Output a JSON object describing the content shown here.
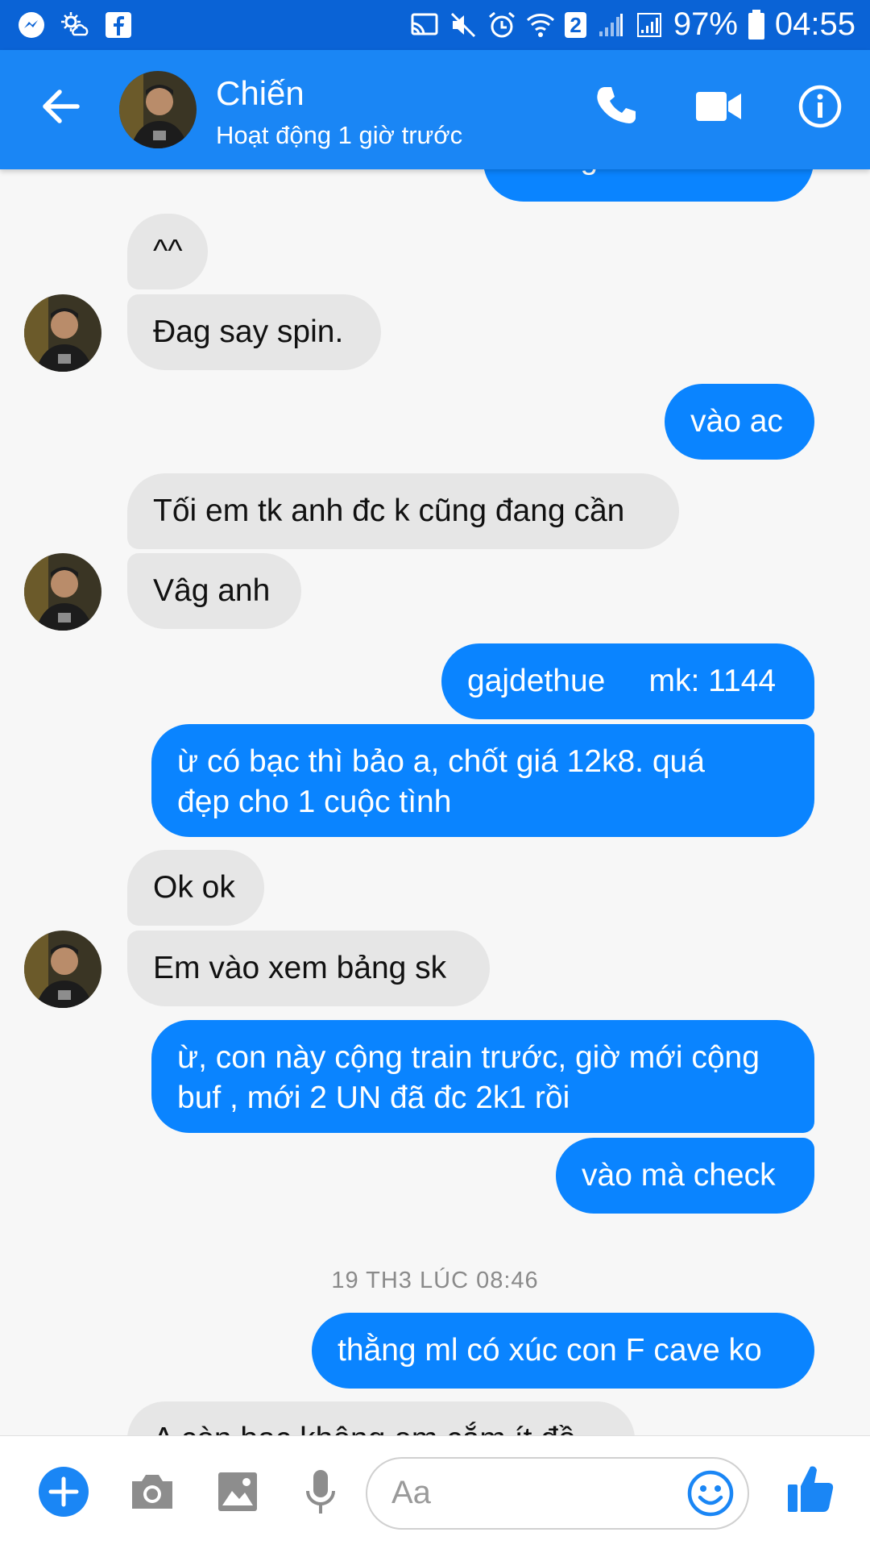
{
  "status_bar": {
    "battery_percent": "97%",
    "time": "04:55",
    "sim_badge": "2"
  },
  "header": {
    "contact_name": "Chiến",
    "activity": "Hoạt động 1 giờ trước"
  },
  "messages": [
    {
      "dir": "out",
      "text": "thằng ml đi đâu rồi"
    },
    {
      "dir": "in",
      "text": "^^"
    },
    {
      "dir": "in",
      "text": "Đag say spin."
    },
    {
      "dir": "out",
      "text": "vào ac"
    },
    {
      "dir": "in",
      "text": "Tối em tk anh đc k cũng đang cần"
    },
    {
      "dir": "in",
      "text": "Vâg anh"
    },
    {
      "dir": "out",
      "text": "gajdethue     mk: 1144"
    },
    {
      "dir": "out",
      "text": "ừ có bạc thì bảo a, chốt giá 12k8. quá\nđẹp cho 1 cuộc tình"
    },
    {
      "dir": "in",
      "text": "Ok ok"
    },
    {
      "dir": "in",
      "text": "Em vào xem bảng sk"
    },
    {
      "dir": "out",
      "text": "ừ, con này cộng train trước, giờ mới cộng\nbuf , mới 2 UN đã đc 2k1 rồi"
    },
    {
      "dir": "out",
      "text": "vào mà check"
    },
    {
      "dir": "out",
      "text": "thằng ml có xúc con F cave ko"
    },
    {
      "dir": "in",
      "text": "A còn bạc không em cắm ít đồ"
    }
  ],
  "timestamp_separator": "19 TH3 LÚC 08:46",
  "composer": {
    "placeholder": "Aa"
  },
  "colors": {
    "status_bar": "#0a63d6",
    "header": "#1a86f5",
    "outgoing_bubble": "#0a84ff",
    "incoming_bubble": "#e6e6e6",
    "accent": "#1a86f5"
  },
  "icons": [
    "back-arrow-icon",
    "phone-icon",
    "video-camera-icon",
    "info-icon",
    "add-icon",
    "camera-icon",
    "image-icon",
    "microphone-icon",
    "emoji-icon",
    "like-icon"
  ]
}
